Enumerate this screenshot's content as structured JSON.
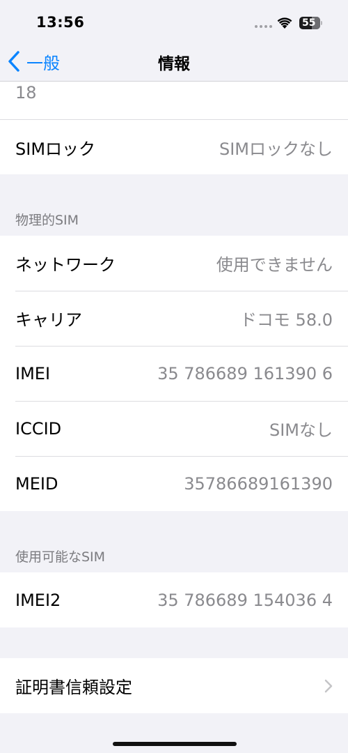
{
  "status_bar": {
    "time": "13:56",
    "battery": "55",
    "icons": [
      "cellular-dots-icon",
      "wifi-icon",
      "battery-icon"
    ]
  },
  "nav": {
    "back_label": "一般",
    "title": "情報"
  },
  "top_partial_value": "18",
  "sim_lock": {
    "label": "SIMロック",
    "value": "SIMロックなし"
  },
  "physical_sim": {
    "header": "物理的SIM",
    "rows": [
      {
        "label": "ネットワーク",
        "value": "使用できません"
      },
      {
        "label": "キャリア",
        "value": "ドコモ 58.0"
      },
      {
        "label": "IMEI",
        "value": "35 786689 161390 6"
      },
      {
        "label": "ICCID",
        "value": "SIMなし"
      },
      {
        "label": "MEID",
        "value": "35786689161390"
      }
    ]
  },
  "available_sim": {
    "header": "使用可能なSIM",
    "rows": [
      {
        "label": "IMEI2",
        "value": "35 786689 154036 4"
      }
    ]
  },
  "certificate_trust": {
    "label": "証明書信頼設定"
  },
  "colors": {
    "accent": "#0a84ff",
    "background": "#f2f2f7",
    "secondary_text": "#8a8a8e"
  }
}
